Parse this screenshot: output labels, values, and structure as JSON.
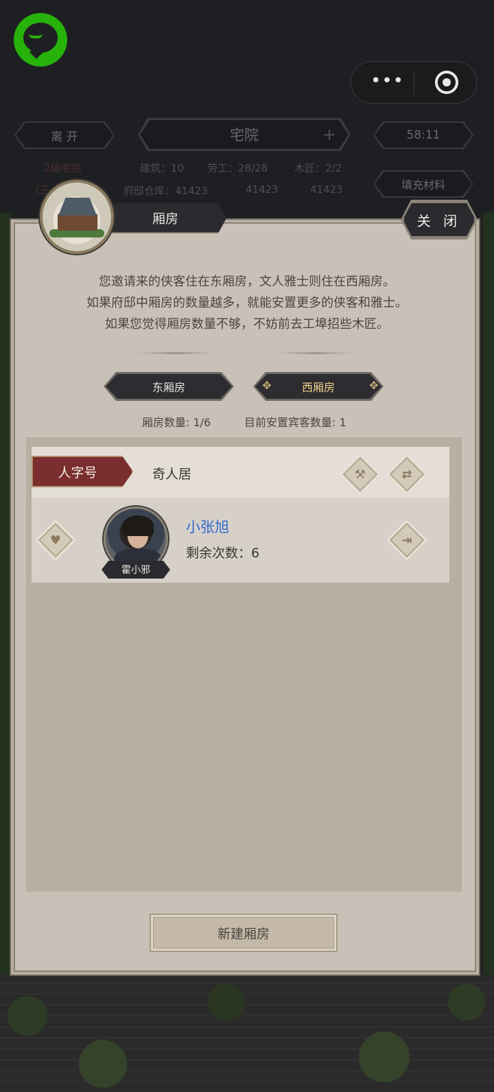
{
  "top_bar": {
    "leave": "离 开",
    "title": "宅院",
    "plus": "+",
    "timer": "58:11",
    "level": "2级宅院",
    "level_extra": "(三",
    "building": "建筑：10",
    "labor": "劳工：28/28",
    "carpenter": "木匠：2/2",
    "warehouse": "府邸仓库：41423",
    "res2": "41423",
    "res3": "41423",
    "fill": "填充材料"
  },
  "capsule": {
    "more": "•••"
  },
  "dialog": {
    "title": "厢房",
    "close": "关 闭",
    "desc": [
      "您邀请来的侠客住在东厢房，文人雅士则住在西厢房。",
      "如果府邸中厢房的数量越多，就能安置更多的侠客和雅士。",
      "如果您觉得厢房数量不够，不妨前去工埠招些木匠。"
    ],
    "tabs": [
      {
        "label": "东厢房",
        "active": false
      },
      {
        "label": "西厢房",
        "active": true
      }
    ],
    "stats": {
      "room_count": "厢房数量: 1/6",
      "guest_count": "目前安置宾客数量: 1"
    },
    "rooms": [
      {
        "tag": "人字号",
        "name": "奇人居",
        "guest": {
          "plate": "霍小邪",
          "name": "小张旭",
          "remaining": "剩余次数：6"
        }
      }
    ],
    "new_room": "新建厢房"
  },
  "colors": {
    "wechat_green": "#27b20b",
    "accent_gold": "#efd58a",
    "room_tag_red": "#7a2e2e",
    "guest_name_blue": "#2f6bd0"
  },
  "icons": [
    "wechat-logo-icon",
    "more-dots-icon",
    "target-icon",
    "hammer-icon",
    "swap-icon",
    "heart-icon",
    "exit-icon"
  ]
}
